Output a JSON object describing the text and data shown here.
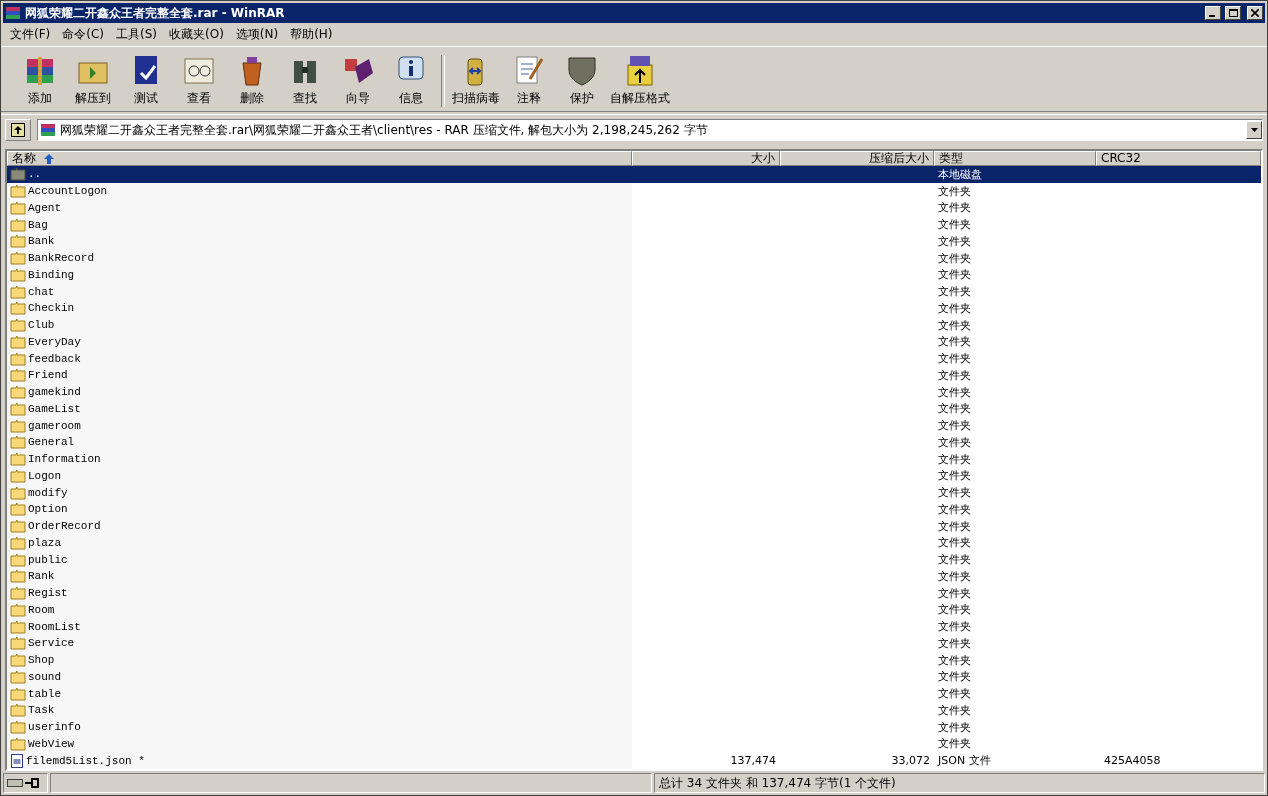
{
  "window": {
    "title": "网狐荣耀二开鑫众王者完整全套.rar - WinRAR"
  },
  "menu": [
    "文件(F)",
    "命令(C)",
    "工具(S)",
    "收藏夹(O)",
    "选项(N)",
    "帮助(H)"
  ],
  "toolbar": [
    {
      "label": "添加"
    },
    {
      "label": "解压到"
    },
    {
      "label": "测试"
    },
    {
      "label": "查看"
    },
    {
      "label": "删除"
    },
    {
      "label": "查找"
    },
    {
      "label": "向导"
    },
    {
      "label": "信息"
    },
    {
      "label": "扫描病毒"
    },
    {
      "label": "注释"
    },
    {
      "label": "保护"
    },
    {
      "label": "自解压格式"
    }
  ],
  "address": {
    "path": "网狐荣耀二开鑫众王者完整全套.rar\\网狐荣耀二开鑫众王者\\client\\res - RAR 压缩文件, 解包大小为 2,198,245,262 字节"
  },
  "table": {
    "columns": [
      "名称",
      "大小",
      "压缩后大小",
      "类型",
      "CRC32"
    ],
    "rows": [
      {
        "kind": "up",
        "name": "..",
        "size": "",
        "packed": "",
        "type": "本地磁盘",
        "crc": "",
        "selected": true
      },
      {
        "kind": "folder",
        "name": "AccountLogon",
        "type": "文件夹",
        "selected": false
      },
      {
        "kind": "folder",
        "name": "Agent",
        "type": "文件夹",
        "selected": false
      },
      {
        "kind": "folder",
        "name": "Bag",
        "type": "文件夹",
        "selected": false
      },
      {
        "kind": "folder",
        "name": "Bank",
        "type": "文件夹",
        "selected": false
      },
      {
        "kind": "folder",
        "name": "BankRecord",
        "type": "文件夹",
        "selected": false
      },
      {
        "kind": "folder",
        "name": "Binding",
        "type": "文件夹",
        "selected": false
      },
      {
        "kind": "folder",
        "name": "chat",
        "type": "文件夹",
        "selected": false
      },
      {
        "kind": "folder",
        "name": "Checkin",
        "type": "文件夹",
        "selected": false
      },
      {
        "kind": "folder",
        "name": "Club",
        "type": "文件夹",
        "selected": false
      },
      {
        "kind": "folder",
        "name": "EveryDay",
        "type": "文件夹",
        "selected": false
      },
      {
        "kind": "folder",
        "name": "feedback",
        "type": "文件夹",
        "selected": false
      },
      {
        "kind": "folder",
        "name": "Friend",
        "type": "文件夹",
        "selected": false
      },
      {
        "kind": "folder",
        "name": "gamekind",
        "type": "文件夹",
        "selected": false
      },
      {
        "kind": "folder",
        "name": "GameList",
        "type": "文件夹",
        "selected": false
      },
      {
        "kind": "folder",
        "name": "gameroom",
        "type": "文件夹",
        "selected": false
      },
      {
        "kind": "folder",
        "name": "General",
        "type": "文件夹",
        "selected": false
      },
      {
        "kind": "folder",
        "name": "Information",
        "type": "文件夹",
        "selected": false
      },
      {
        "kind": "folder",
        "name": "Logon",
        "type": "文件夹",
        "selected": false
      },
      {
        "kind": "folder",
        "name": "modify",
        "type": "文件夹",
        "selected": false
      },
      {
        "kind": "folder",
        "name": "Option",
        "type": "文件夹",
        "selected": false
      },
      {
        "kind": "folder",
        "name": "OrderRecord",
        "type": "文件夹",
        "selected": false
      },
      {
        "kind": "folder",
        "name": "plaza",
        "type": "文件夹",
        "selected": false
      },
      {
        "kind": "folder",
        "name": "public",
        "type": "文件夹",
        "selected": false
      },
      {
        "kind": "folder",
        "name": "Rank",
        "type": "文件夹",
        "selected": false
      },
      {
        "kind": "folder",
        "name": "Regist",
        "type": "文件夹",
        "selected": false
      },
      {
        "kind": "folder",
        "name": "Room",
        "type": "文件夹",
        "selected": false
      },
      {
        "kind": "folder",
        "name": "RoomList",
        "type": "文件夹",
        "selected": false
      },
      {
        "kind": "folder",
        "name": "Service",
        "type": "文件夹",
        "selected": false
      },
      {
        "kind": "folder",
        "name": "Shop",
        "type": "文件夹",
        "selected": false
      },
      {
        "kind": "folder",
        "name": "sound",
        "type": "文件夹",
        "selected": false
      },
      {
        "kind": "folder",
        "name": "table",
        "type": "文件夹",
        "selected": false
      },
      {
        "kind": "folder",
        "name": "Task",
        "type": "文件夹",
        "selected": false
      },
      {
        "kind": "folder",
        "name": "userinfo",
        "type": "文件夹",
        "selected": false
      },
      {
        "kind": "folder",
        "name": "WebView",
        "type": "文件夹",
        "selected": false
      },
      {
        "kind": "file",
        "name": "filemd5List.json *",
        "size": "137,474",
        "packed": "33,072",
        "type": "JSON 文件",
        "crc": "425A4058",
        "selected": false
      }
    ]
  },
  "status_bar": {
    "text": "总计 34 文件夹 和 137,474 字节(1 个文件)"
  }
}
